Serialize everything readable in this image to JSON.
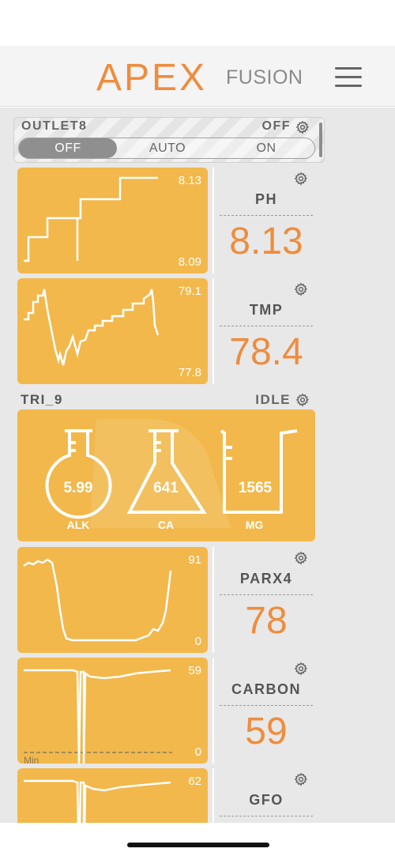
{
  "app": {
    "logo_primary": "APEX",
    "logo_secondary": "FUSION"
  },
  "icons": {
    "menu": "hamburger-icon",
    "gear": "gear-icon"
  },
  "colors": {
    "accent": "#ee8d3e",
    "card": "#f2b84b",
    "background": "#e8e8e8"
  },
  "outlet": {
    "name": "OUTLET8",
    "state": "OFF",
    "options": [
      "OFF",
      "AUTO",
      "ON"
    ],
    "selected": "OFF"
  },
  "probes": [
    {
      "name": "PH",
      "value": "8.13",
      "chart_max": "8.13",
      "chart_min": "8.09"
    },
    {
      "name": "TMP",
      "value": "78.4",
      "chart_max": "79.1",
      "chart_min": "77.8"
    },
    {
      "name": "PARX4",
      "value": "78",
      "chart_max": "91",
      "chart_min": "0"
    },
    {
      "name": "CARBON",
      "value": "59",
      "chart_max": "59",
      "chart_min": "0",
      "threshold_label": "Min"
    },
    {
      "name": "GFO",
      "value": "",
      "chart_max": "62",
      "chart_min": ""
    }
  ],
  "trident": {
    "name": "TRI_9",
    "state": "IDLE",
    "tests": [
      {
        "label": "ALK",
        "value": "5.99"
      },
      {
        "label": "CA",
        "value": "641"
      },
      {
        "label": "MG",
        "value": "1565"
      }
    ]
  }
}
